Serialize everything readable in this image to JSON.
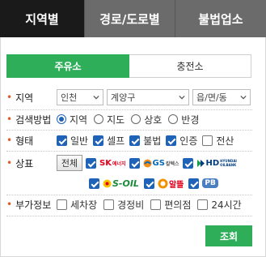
{
  "top_tabs": [
    "지역별",
    "경로/도로별",
    "불법업소"
  ],
  "sub_tabs": [
    "주유소",
    "충전소"
  ],
  "filters": {
    "region": {
      "label": "지역",
      "selects": [
        "인천",
        "계양구",
        "읍/면/동"
      ]
    },
    "search_method": {
      "label": "검색방법",
      "options": [
        "지역",
        "지도",
        "상호",
        "반경"
      ],
      "selected": "지역"
    },
    "type": {
      "label": "형태",
      "options": [
        {
          "label": "일반",
          "checked": true
        },
        {
          "label": "셀프",
          "checked": true
        },
        {
          "label": "불법",
          "checked": true
        },
        {
          "label": "인증",
          "checked": true
        },
        {
          "label": "전산",
          "checked": false
        }
      ]
    },
    "brand": {
      "label": "상표",
      "all_button": "전체",
      "items": [
        {
          "name": "SK에너지",
          "text": "SK",
          "sub": "에너지",
          "checked": true
        },
        {
          "name": "GS칼텍스",
          "text": "GS",
          "sub": "칼텍스",
          "checked": true
        },
        {
          "name": "HD현대오일뱅크",
          "text": "HD",
          "sub": "HYUNDAI OILBANK",
          "checked": true
        },
        {
          "name": "S-OIL",
          "text": "S-OIL",
          "checked": true
        },
        {
          "name": "알뜰",
          "text": "알뜰",
          "checked": true
        },
        {
          "name": "PB",
          "text": "PB",
          "checked": true
        }
      ]
    },
    "extra": {
      "label": "부가정보",
      "options": [
        {
          "label": "세차장",
          "checked": false
        },
        {
          "label": "경정비",
          "checked": false
        },
        {
          "label": "편의점",
          "checked": false
        },
        {
          "label": "24시간",
          "checked": false
        }
      ]
    }
  },
  "search_button": "조회",
  "colors": {
    "accent_green": "#2fae5a",
    "check_blue": "#1e63b8",
    "tab_dark": "#1a1a1a",
    "tab_gray": "#6b6b6b"
  }
}
